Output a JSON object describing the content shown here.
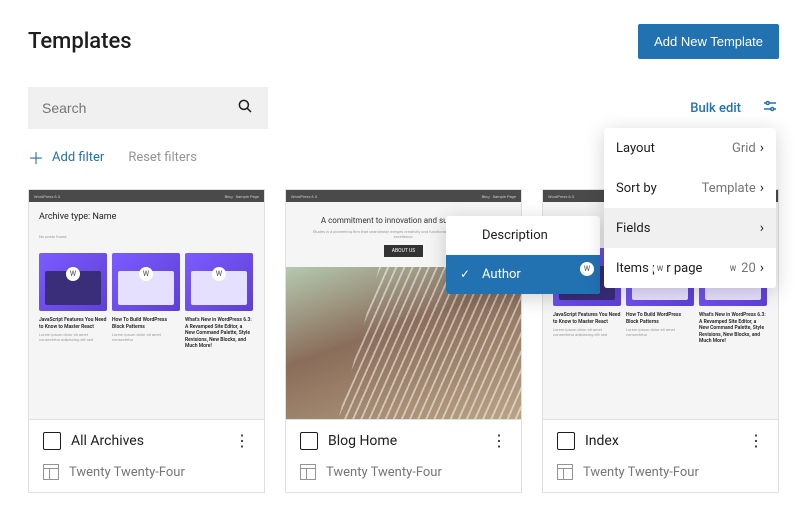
{
  "header": {
    "title": "Templates",
    "add_button": "Add New Template"
  },
  "toolbar": {
    "search_placeholder": "Search",
    "bulk_edit": "Bulk edit"
  },
  "filters": {
    "add_filter": "Add filter",
    "reset_filters": "Reset filters"
  },
  "cards": [
    {
      "preview_heading": "Archive type: Name",
      "captions": [
        {
          "title": "JavaScript Features You Need to Know to Master React"
        },
        {
          "title": "How To Build WordPress Block Patterns"
        },
        {
          "title": "What's New in WordPress 6.3: A Revamped Site Editor, a New Command Palette, Style Revisions, New Blocks, and Much More!"
        }
      ],
      "name": "All Archives",
      "theme": "Twenty Twenty-Four"
    },
    {
      "hero_line": "A commitment to innovation and sustainability",
      "hero_btn": "ABOUT US",
      "name": "Blog Home",
      "theme": "Twenty Twenty-Four"
    },
    {
      "captions": [
        {
          "title": "JavaScript Features You Need to Know to Master React"
        },
        {
          "title": "How To Build WordPress Block Patterns"
        },
        {
          "title": "What's New in WordPress 6.3: A Revamped Site Editor, a New Command Palette, Style Revisions, New Blocks, and Much More!"
        }
      ],
      "name": "Index",
      "theme": "Twenty Twenty-Four"
    }
  ],
  "fields_menu": [
    {
      "label": "Description",
      "selected": false
    },
    {
      "label": "Author",
      "selected": true
    }
  ],
  "view_menu": {
    "layout": {
      "label": "Layout",
      "value": "Grid"
    },
    "sort": {
      "label": "Sort by",
      "value": "Template"
    },
    "fields": {
      "label": "Fields",
      "value": ""
    },
    "per_page": {
      "label": "Items per page",
      "value": "20"
    }
  }
}
